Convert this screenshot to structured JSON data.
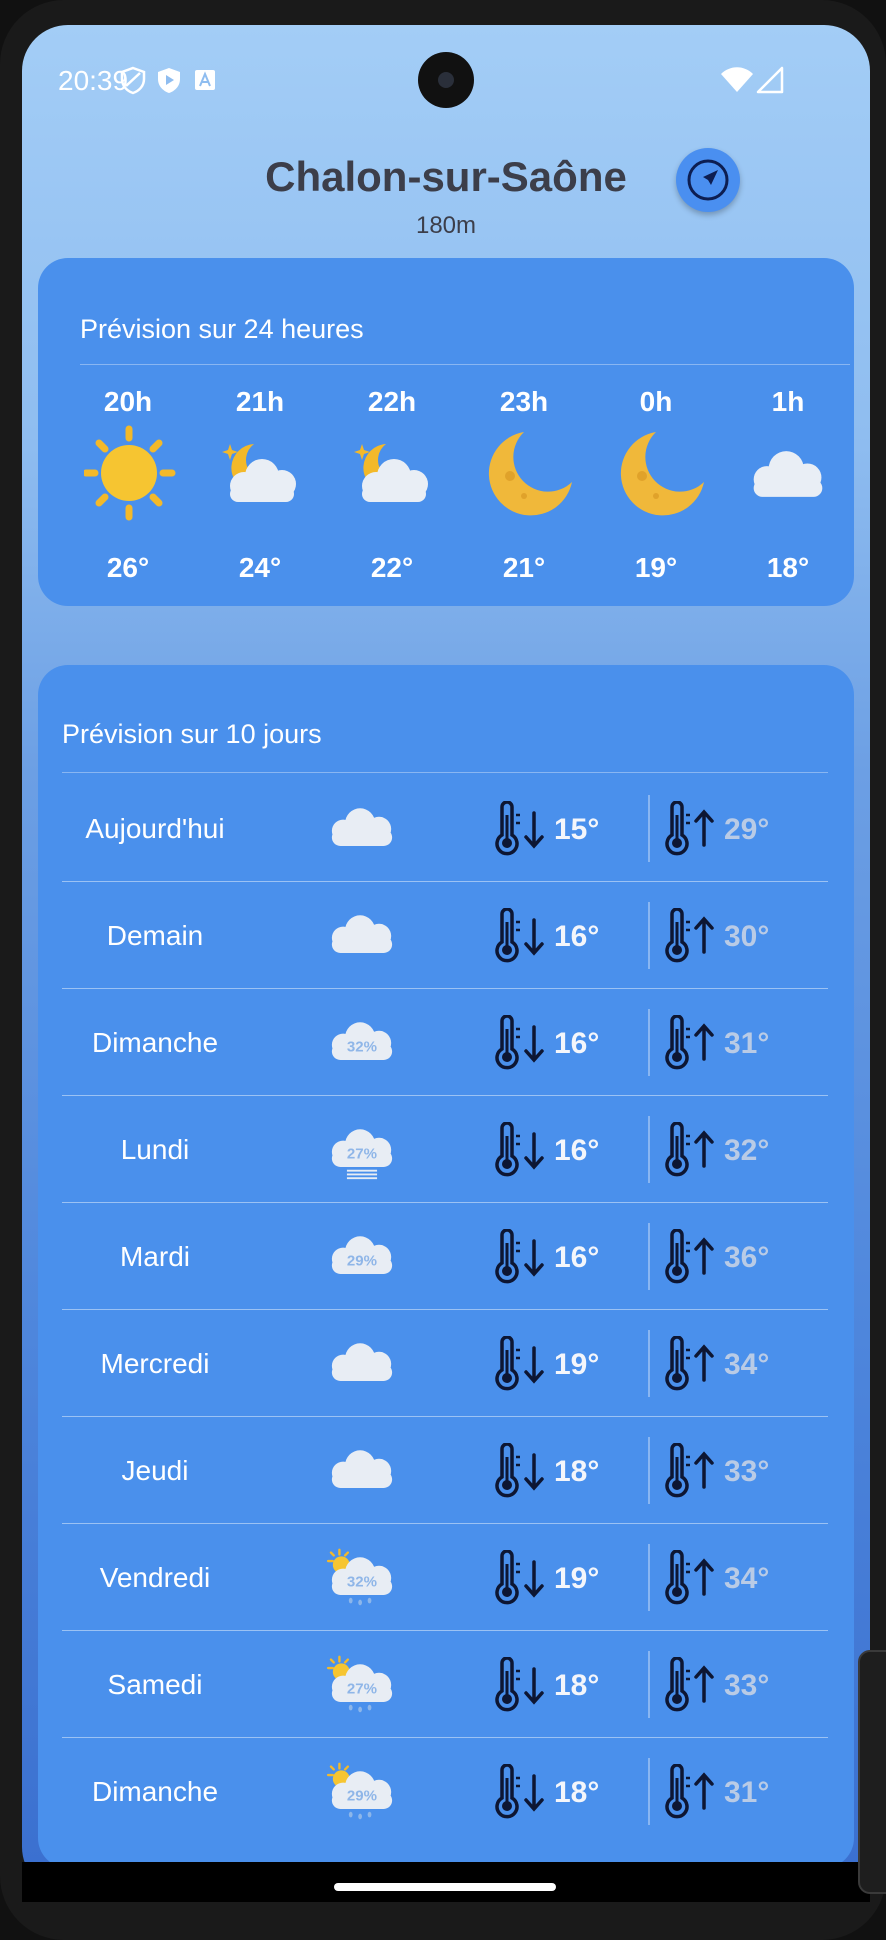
{
  "status_bar": {
    "time": "20:39"
  },
  "location": {
    "city": "Chalon-sur-Saône",
    "altitude": "180m"
  },
  "hourly": {
    "title": "Prévision sur 24 heures",
    "items": [
      {
        "hour": "20h",
        "icon": "sun-icon",
        "temp": "26°"
      },
      {
        "hour": "21h",
        "icon": "cloudy-night-icon",
        "temp": "24°"
      },
      {
        "hour": "22h",
        "icon": "cloudy-night-icon",
        "temp": "22°"
      },
      {
        "hour": "23h",
        "icon": "moon-icon",
        "temp": "21°"
      },
      {
        "hour": "0h",
        "icon": "moon-icon",
        "temp": "19°"
      },
      {
        "hour": "1h",
        "icon": "cloud-icon",
        "temp": "18°"
      }
    ]
  },
  "daily": {
    "title": "Prévision sur 10 jours",
    "items": [
      {
        "day": "Aujourd'hui",
        "icon": "cloud-icon",
        "precip": "",
        "min": "15°",
        "max": "29°"
      },
      {
        "day": "Demain",
        "icon": "cloud-icon",
        "precip": "",
        "min": "16°",
        "max": "30°"
      },
      {
        "day": "Dimanche",
        "icon": "cloud-percent-icon",
        "precip": "32%",
        "min": "16°",
        "max": "31°"
      },
      {
        "day": "Lundi",
        "icon": "fog-cloud-icon",
        "precip": "27%",
        "min": "16°",
        "max": "32°"
      },
      {
        "day": "Mardi",
        "icon": "cloud-percent-icon",
        "precip": "29%",
        "min": "16°",
        "max": "36°"
      },
      {
        "day": "Mercredi",
        "icon": "cloud-icon",
        "precip": "",
        "min": "19°",
        "max": "34°"
      },
      {
        "day": "Jeudi",
        "icon": "cloud-icon",
        "precip": "",
        "min": "18°",
        "max": "33°"
      },
      {
        "day": "Vendredi",
        "icon": "sun-rain-cloud-icon",
        "precip": "32%",
        "min": "19°",
        "max": "34°"
      },
      {
        "day": "Samedi",
        "icon": "sun-rain-cloud-icon",
        "precip": "27%",
        "min": "18°",
        "max": "33°"
      },
      {
        "day": "Dimanche",
        "icon": "sun-rain-cloud-icon",
        "precip": "29%",
        "min": "18°",
        "max": "31°"
      }
    ]
  },
  "colors": {
    "card": "#4a90ec",
    "min_temp": "#f4f6fb",
    "max_temp": "#b9cbe6",
    "city": "#3c3e4a"
  }
}
